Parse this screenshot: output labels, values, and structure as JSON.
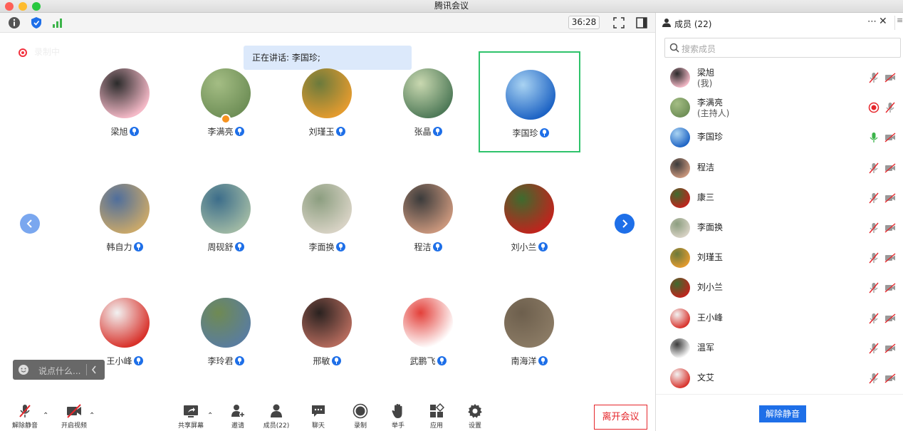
{
  "window": {
    "title": "腾讯会议"
  },
  "toolbar": {
    "timer": "36:28"
  },
  "stage": {
    "recording_label": "录制中",
    "speaking_text": "正在讲话: 李国珍;",
    "chat_placeholder": "说点什么..."
  },
  "tiles": [
    {
      "name": "梁旭",
      "colors": [
        "#f4b9c7",
        "#2b2b2b"
      ]
    },
    {
      "name": "李满亮",
      "colors": [
        "#6f8f57",
        "#a4bd84"
      ],
      "host": true
    },
    {
      "name": "刘瑾玉",
      "colors": [
        "#e39b2f",
        "#6b7a3c"
      ]
    },
    {
      "name": "张晶",
      "colors": [
        "#4f7a58",
        "#c9d8b0"
      ]
    },
    {
      "name": "李国珍",
      "colors": [
        "#1d63c4",
        "#a9d3f2"
      ],
      "active": true
    },
    {
      "name": "韩自力",
      "colors": [
        "#c9a86a",
        "#4f6e9c"
      ]
    },
    {
      "name": "周砚舒",
      "colors": [
        "#9eb8a4",
        "#3c6d8a"
      ]
    },
    {
      "name": "李面换",
      "colors": [
        "#d7d2c4",
        "#8c9e80"
      ]
    },
    {
      "name": "程洁",
      "colors": [
        "#c9967c",
        "#3b3b3b"
      ]
    },
    {
      "name": "刘小兰",
      "colors": [
        "#c0241d",
        "#3e6b2e"
      ]
    },
    {
      "name": "王小峰",
      "colors": [
        "#d8312a",
        "#f2f2f2"
      ]
    },
    {
      "name": "李玲君",
      "colors": [
        "#5a7d9e",
        "#6f8a53"
      ]
    },
    {
      "name": "邢敏",
      "colors": [
        "#b46a5c",
        "#2a2220"
      ]
    },
    {
      "name": "武鹏飞",
      "colors": [
        "#ffffff",
        "#e3403a"
      ]
    },
    {
      "name": "南海洋",
      "colors": [
        "#8a7a64",
        "#6d5f4d"
      ]
    }
  ],
  "bottombar": {
    "unmute": "解除静音",
    "start_video": "开启视频",
    "share_screen": "共享屏幕",
    "invite": "邀请",
    "members": "成员(22)",
    "chat": "聊天",
    "record": "录制",
    "raise_hand": "举手",
    "apps": "应用",
    "settings": "设置",
    "leave": "离开会议"
  },
  "panel": {
    "title": "成员 (22)",
    "search_placeholder": "搜索成员",
    "unmute_all": "解除静音",
    "members": [
      {
        "name": "梁旭",
        "role": "(我)",
        "colors": [
          "#f4b9c7",
          "#2b2b2b"
        ],
        "mic": "muted",
        "cam": "off"
      },
      {
        "name": "李满亮",
        "role": "(主持人)",
        "colors": [
          "#6f8f57",
          "#a4bd84"
        ],
        "mic": "muted",
        "cam": "recording"
      },
      {
        "name": "李国珍",
        "role": "",
        "colors": [
          "#1d63c4",
          "#a9d3f2"
        ],
        "mic": "active",
        "cam": "off"
      },
      {
        "name": "程洁",
        "role": "",
        "colors": [
          "#c9967c",
          "#3b3b3b"
        ],
        "mic": "muted",
        "cam": "off"
      },
      {
        "name": "康三",
        "role": "",
        "colors": [
          "#c0241d",
          "#3e6b2e"
        ],
        "mic": "muted",
        "cam": "off"
      },
      {
        "name": "李面换",
        "role": "",
        "colors": [
          "#d7d2c4",
          "#8c9e80"
        ],
        "mic": "muted",
        "cam": "off"
      },
      {
        "name": "刘瑾玉",
        "role": "",
        "colors": [
          "#e39b2f",
          "#6b7a3c"
        ],
        "mic": "muted",
        "cam": "off"
      },
      {
        "name": "刘小兰",
        "role": "",
        "colors": [
          "#c0241d",
          "#3e6b2e"
        ],
        "mic": "muted",
        "cam": "off"
      },
      {
        "name": "王小峰",
        "role": "",
        "colors": [
          "#d8312a",
          "#f2f2f2"
        ],
        "mic": "muted",
        "cam": "off"
      },
      {
        "name": "温军",
        "role": "",
        "colors": [
          "#ffffff",
          "#3b3b3b"
        ],
        "mic": "muted",
        "cam": "off"
      },
      {
        "name": "文艾",
        "role": "",
        "colors": [
          "#d8312a",
          "#f2f2f2"
        ],
        "mic": "muted",
        "cam": "off"
      }
    ]
  },
  "colors": {
    "accent": "#1e6fe8",
    "danger": "#e5262b",
    "active_border": "#2fc36b"
  }
}
